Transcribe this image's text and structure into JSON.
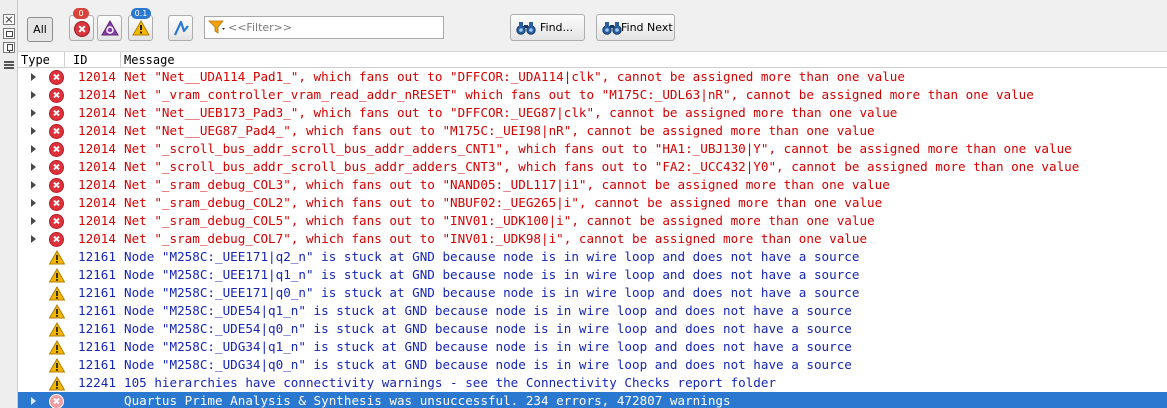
{
  "left_strip": {
    "icons": [
      "close-icon",
      "float-icon",
      "pin-icon",
      "menu-icon"
    ]
  },
  "toolbar": {
    "all_label": "All",
    "error_badge": "0",
    "warning_badge": "0.1",
    "filter_placeholder": "<<Filter>>",
    "find_label": "Find...",
    "find_next_label": "Find Next",
    "colors": {
      "error": "#e0313b",
      "critical": "#8a3fa8",
      "warning": "#f2b705",
      "flow": "#2b78d0"
    }
  },
  "table": {
    "columns": [
      "Type",
      "ID",
      "Message"
    ],
    "rows": [
      {
        "type": "error",
        "id": "12014",
        "message": "Net \"Net__UDA114_Pad1_\", which fans out to \"DFFCOR:_UDA114|clk\", cannot be assigned more than one value",
        "expandable": true
      },
      {
        "type": "error",
        "id": "12014",
        "message": "Net \"_vram_controller_vram_read_addr_nRESET\" which fans out to \"M175C:_UDL63|nR\", cannot be assigned more than one value",
        "expandable": true
      },
      {
        "type": "error",
        "id": "12014",
        "message": "Net \"Net__UEB173_Pad3_\", which fans out to \"DFFCOR:_UEG87|clk\", cannot be assigned more than one value",
        "expandable": true
      },
      {
        "type": "error",
        "id": "12014",
        "message": "Net \"Net__UEG87_Pad4_\", which fans out to \"M175C:_UEI98|nR\", cannot be assigned more than one value",
        "expandable": true
      },
      {
        "type": "error",
        "id": "12014",
        "message": "Net \"_scroll_bus_addr_scroll_bus_addr_adders_CNT1\", which fans out to \"HA1:_UBJ130|Y\", cannot be assigned more than one value",
        "expandable": true
      },
      {
        "type": "error",
        "id": "12014",
        "message": "Net \"_scroll_bus_addr_scroll_bus_addr_adders_CNT3\", which fans out to \"FA2:_UCC432|Y0\", cannot be assigned more than one value",
        "expandable": true
      },
      {
        "type": "error",
        "id": "12014",
        "message": "Net \"_sram_debug_COL3\", which fans out to \"NAND05:_UDL117|i1\", cannot be assigned more than one value",
        "expandable": true
      },
      {
        "type": "error",
        "id": "12014",
        "message": "Net \"_sram_debug_COL2\", which fans out to \"NBUF02:_UEG265|i\", cannot be assigned more than one value",
        "expandable": true
      },
      {
        "type": "error",
        "id": "12014",
        "message": "Net \"_sram_debug_COL5\", which fans out to \"INV01:_UDK100|i\", cannot be assigned more than one value",
        "expandable": true
      },
      {
        "type": "error",
        "id": "12014",
        "message": "Net \"_sram_debug_COL7\", which fans out to \"INV01:_UDK98|i\", cannot be assigned more than one value",
        "expandable": true
      },
      {
        "type": "warning",
        "id": "12161",
        "message": "Node \"M258C:_UEE171|q2_n\" is stuck at GND because node is in wire loop and does not have a source",
        "expandable": false
      },
      {
        "type": "warning",
        "id": "12161",
        "message": "Node \"M258C:_UEE171|q1_n\" is stuck at GND because node is in wire loop and does not have a source",
        "expandable": false
      },
      {
        "type": "warning",
        "id": "12161",
        "message": "Node \"M258C:_UEE171|q0_n\" is stuck at GND because node is in wire loop and does not have a source",
        "expandable": false
      },
      {
        "type": "warning",
        "id": "12161",
        "message": "Node \"M258C:_UDE54|q1_n\" is stuck at GND because node is in wire loop and does not have a source",
        "expandable": false
      },
      {
        "type": "warning",
        "id": "12161",
        "message": "Node \"M258C:_UDE54|q0_n\" is stuck at GND because node is in wire loop and does not have a source",
        "expandable": false
      },
      {
        "type": "warning",
        "id": "12161",
        "message": "Node \"M258C:_UDG34|q1_n\" is stuck at GND because node is in wire loop and does not have a source",
        "expandable": false
      },
      {
        "type": "warning",
        "id": "12161",
        "message": "Node \"M258C:_UDG34|q0_n\" is stuck at GND because node is in wire loop and does not have a source",
        "expandable": false
      },
      {
        "type": "warning",
        "id": "12241",
        "message": "105 hierarchies have connectivity warnings - see the Connectivity Checks report folder",
        "expandable": false
      },
      {
        "type": "error",
        "id": "",
        "message": "Quartus Prime Analysis & Synthesis was unsuccessful. 234 errors, 472807 warnings",
        "expandable": true,
        "selected": true
      }
    ]
  }
}
